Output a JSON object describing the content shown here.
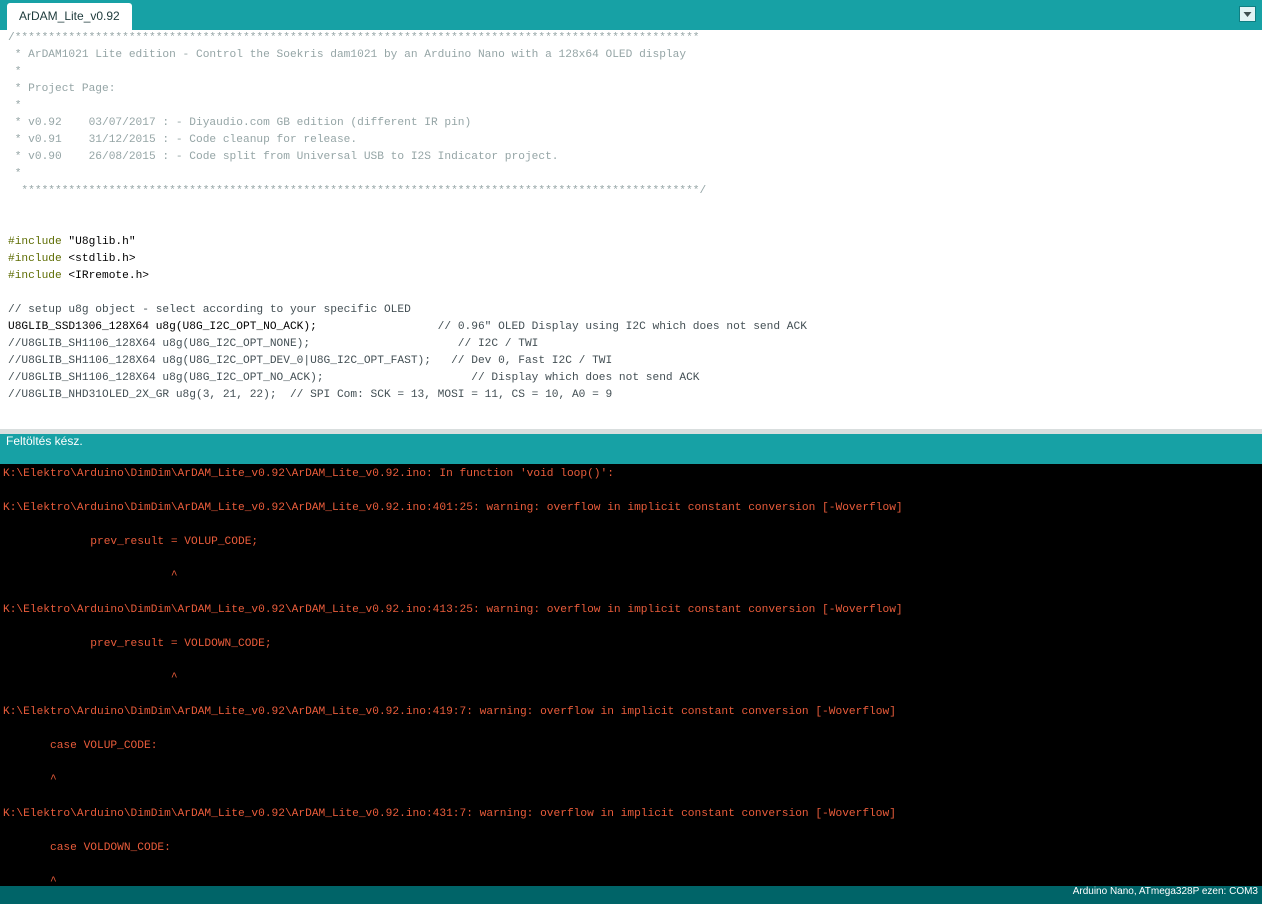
{
  "tab": {
    "label": "ArDAM_Lite_v0.92"
  },
  "tab_menu": {
    "icon": "triangle-down-icon"
  },
  "editor": {
    "header_comment": [
      "/******************************************************************************************************",
      " * ArDAM1021 Lite edition - Control the Soekris dam1021 by an Arduino Nano with a 128x64 OLED display",
      " *",
      " * Project Page:",
      " *",
      " * v0.92    03/07/2017 : - Diyaudio.com GB edition (different IR pin)",
      " * v0.91    31/12/2015 : - Code cleanup for release.",
      " * v0.90    26/08/2015 : - Code split from Universal USB to I2S Indicator project.",
      " *",
      "  *****************************************************************************************************/"
    ],
    "includes": [
      {
        "directive": "#include",
        "file": " \"U8glib.h\""
      },
      {
        "directive": "#include",
        "file": " <stdlib.h>"
      },
      {
        "directive": "#include",
        "file": " <IRremote.h>"
      }
    ],
    "setup_comment": "// setup u8g object - select according to your specific OLED",
    "active_line": {
      "code": "U8GLIB_SSD1306_128X64 u8g(U8G_I2C_OPT_NO_ACK);                  ",
      "comment": "// 0.96\" OLED Display using I2C which does not send ACK"
    },
    "commented_lines": [
      "//U8GLIB_SH1106_128X64 u8g(U8G_I2C_OPT_NONE);                      // I2C / TWI",
      "//U8GLIB_SH1106_128X64 u8g(U8G_I2C_OPT_DEV_0|U8G_I2C_OPT_FAST);   // Dev 0, Fast I2C / TWI",
      "//U8GLIB_SH1106_128X64 u8g(U8G_I2C_OPT_NO_ACK);                      // Display which does not send ACK",
      "//U8GLIB_NHD31OLED_2X_GR u8g(3, 21, 22);  // SPI Com: SCK = 13, MOSI = 11, CS = 10, A0 = 9"
    ]
  },
  "status": {
    "message": "Feltöltés kész."
  },
  "console": {
    "lines": [
      "K:\\Elektro\\Arduino\\DimDim\\ArDAM_Lite_v0.92\\ArDAM_Lite_v0.92.ino: In function 'void loop()':",
      "K:\\Elektro\\Arduino\\DimDim\\ArDAM_Lite_v0.92\\ArDAM_Lite_v0.92.ino:401:25: warning: overflow in implicit constant conversion [-Woverflow]",
      "             prev_result = VOLUP_CODE;",
      "                         ^",
      "K:\\Elektro\\Arduino\\DimDim\\ArDAM_Lite_v0.92\\ArDAM_Lite_v0.92.ino:413:25: warning: overflow in implicit constant conversion [-Woverflow]",
      "             prev_result = VOLDOWN_CODE;",
      "                         ^",
      "K:\\Elektro\\Arduino\\DimDim\\ArDAM_Lite_v0.92\\ArDAM_Lite_v0.92.ino:419:7: warning: overflow in implicit constant conversion [-Woverflow]",
      "       case VOLUP_CODE:",
      "       ^",
      "K:\\Elektro\\Arduino\\DimDim\\ArDAM_Lite_v0.92\\ArDAM_Lite_v0.92.ino:431:7: warning: overflow in implicit constant conversion [-Woverflow]",
      "       case VOLDOWN_CODE:",
      "       ^"
    ]
  },
  "footer": {
    "board": "Arduino Nano, ATmega328P ezen: COM3"
  },
  "colors": {
    "teal": "#17a1a5",
    "footer_teal": "#006468",
    "console_text": "#ea5c3b",
    "comment_gray": "#95a5a6",
    "keyword_olive": "#5e6d03"
  }
}
